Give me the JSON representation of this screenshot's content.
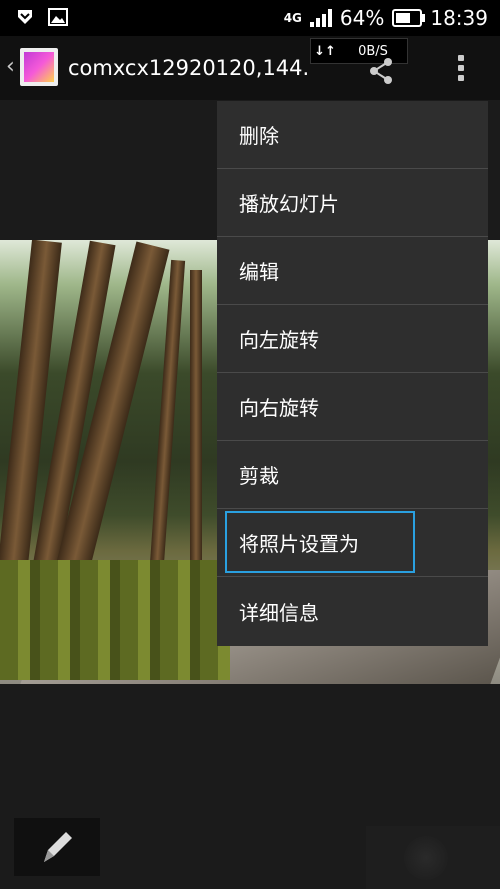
{
  "status_bar": {
    "network_type": "4G",
    "battery_percent": "64%",
    "battery_level": 0.64,
    "time": "18:39"
  },
  "action_bar": {
    "back_glyph": "‹",
    "title": "comxcx12920120,144.",
    "app_icon": "gallery-app-icon",
    "share_icon": "share-icon",
    "overflow_icon": "overflow-menu-icon"
  },
  "network_speed": {
    "arrows": "↓↑",
    "value": "0B/S"
  },
  "photo": {
    "subject": "forest-path-photo"
  },
  "overflow_menu": {
    "items": [
      {
        "label": "删除"
      },
      {
        "label": "播放幻灯片"
      },
      {
        "label": "编辑"
      },
      {
        "label": "向左旋转"
      },
      {
        "label": "向右旋转"
      },
      {
        "label": "剪裁"
      },
      {
        "label": "将照片设置为"
      },
      {
        "label": "详细信息"
      }
    ],
    "selected_index": 6,
    "selection_color": "#2aa0e0"
  },
  "bottom": {
    "edit_icon": "pencil-icon"
  }
}
